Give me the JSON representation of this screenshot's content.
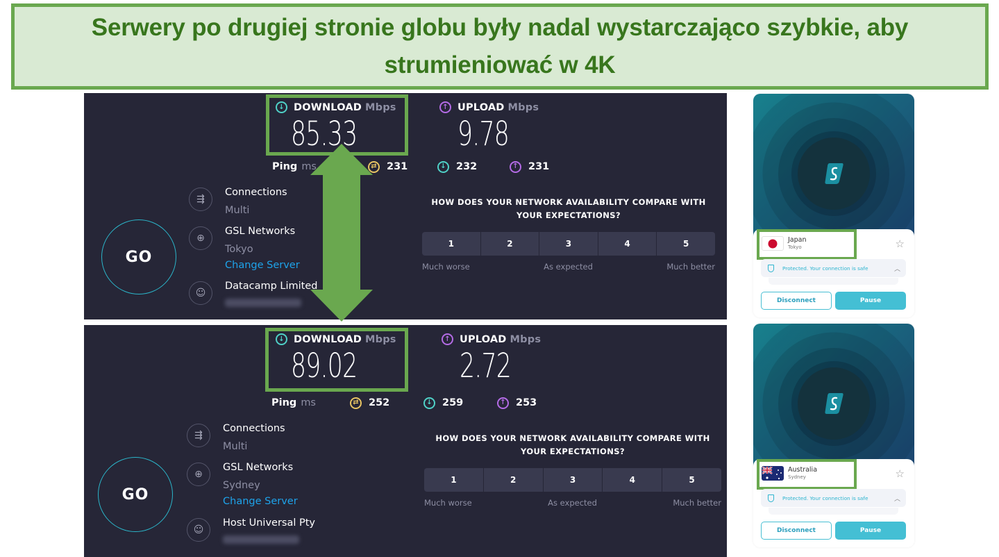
{
  "banner": {
    "title": "Serwery po drugiej stronie globu były nadal wystarczająco szybkie, aby strumieniować w 4K"
  },
  "speedtests": [
    {
      "download_label": "DOWNLOAD",
      "download_unit": "Mbps",
      "download_value": "85.33",
      "upload_label": "UPLOAD",
      "upload_unit": "Mbps",
      "upload_value": "9.78",
      "ping_label": "Ping",
      "ping_unit": "ms",
      "ping_idle": "231",
      "ping_download": "232",
      "ping_upload": "231",
      "go_label": "GO",
      "connections_label": "Connections",
      "connections_value": "Multi",
      "provider": "GSL Networks",
      "server_city": "Tokyo",
      "change_server": "Change Server",
      "isp": "Datacamp Limited",
      "survey_question": "HOW DOES YOUR NETWORK AVAILABILITY COMPARE WITH YOUR EXPECTATIONS?",
      "ratings": [
        "1",
        "2",
        "3",
        "4",
        "5"
      ],
      "rating_low": "Much worse",
      "rating_mid": "As expected",
      "rating_high": "Much better"
    },
    {
      "download_label": "DOWNLOAD",
      "download_unit": "Mbps",
      "download_value": "89.02",
      "upload_label": "UPLOAD",
      "upload_unit": "Mbps",
      "upload_value": "2.72",
      "ping_label": "Ping",
      "ping_unit": "ms",
      "ping_idle": "252",
      "ping_download": "259",
      "ping_upload": "253",
      "go_label": "GO",
      "connections_label": "Connections",
      "connections_value": "Multi",
      "provider": "GSL Networks",
      "server_city": "Sydney",
      "change_server": "Change Server",
      "isp": "Host Universal Pty",
      "survey_question": "HOW DOES YOUR NETWORK AVAILABILITY COMPARE WITH YOUR EXPECTATIONS?",
      "ratings": [
        "1",
        "2",
        "3",
        "4",
        "5"
      ],
      "rating_low": "Much worse",
      "rating_mid": "As expected",
      "rating_high": "Much better"
    }
  ],
  "vpn_cards": [
    {
      "country": "Japan",
      "city": "Tokyo",
      "status": "Protected. Your connection is safe",
      "disconnect_label": "Disconnect",
      "pause_label": "Pause"
    },
    {
      "country": "Australia",
      "city": "Sydney",
      "status": "Protected. Your connection is safe",
      "disconnect_label": "Disconnect",
      "pause_label": "Pause"
    }
  ],
  "colors": {
    "banner_bg": "#d9ead3",
    "banner_border": "#6aa84f",
    "banner_text": "#38761d",
    "panel_bg": "#262637",
    "download_accent": "#4fd1c7",
    "upload_accent": "#b46be6",
    "ping_accent": "#e8c463",
    "link": "#1ea3ea",
    "vpn_accent": "#44bfd4"
  }
}
